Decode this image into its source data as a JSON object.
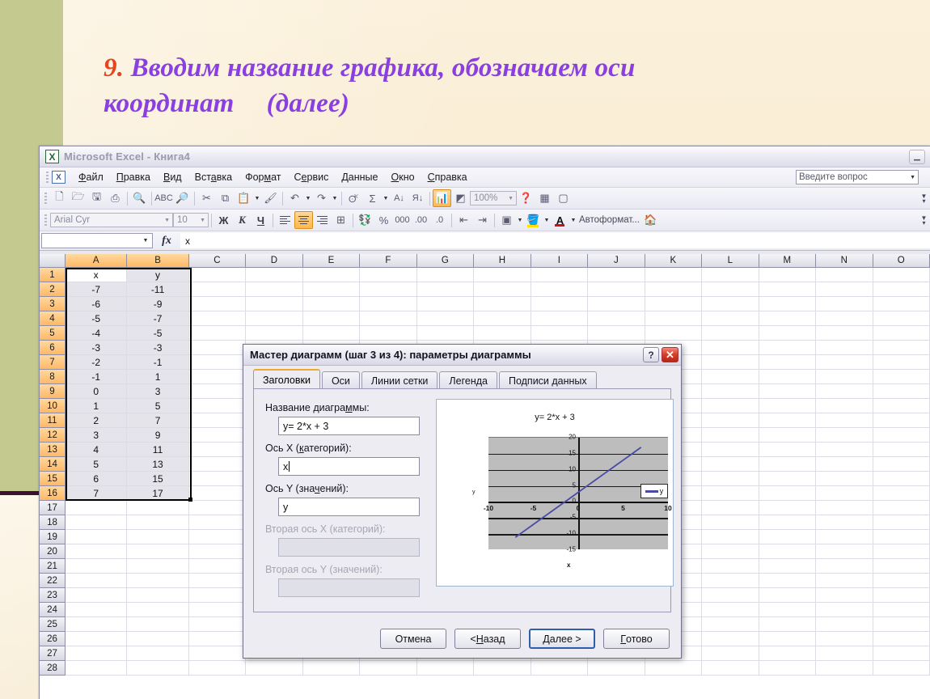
{
  "slide": {
    "number": "9.",
    "title_line1": "Вводим название графика, обозначаем оси",
    "title_line2": "координат",
    "title_line2b": "(далее)",
    "accent_color": "#8a3fe0",
    "number_color": "#e8441c",
    "band_color": "#c3c98f",
    "rule_color": "#3b1033"
  },
  "excel": {
    "title": "Microsoft Excel - Книга4",
    "logo": "excel-logo-icon",
    "window_buttons": [
      "minimize-button"
    ],
    "menu": [
      "Файл",
      "Правка",
      "Вид",
      "Вставка",
      "Формат",
      "Сервис",
      "Данные",
      "Окно",
      "Справка"
    ],
    "ask_box": {
      "placeholder": "Введите вопрос"
    },
    "standard_toolbar": [
      {
        "name": "new-icon",
        "glyph": "▯"
      },
      {
        "name": "open-icon",
        "glyph": "▤"
      },
      {
        "name": "save-icon",
        "glyph": "▣"
      },
      {
        "name": "print-icon",
        "glyph": "⎙"
      },
      {
        "name": "print-preview-icon",
        "glyph": "▦"
      },
      {
        "name": "spellcheck-icon",
        "glyph": "✓"
      },
      {
        "name": "research-icon",
        "glyph": "▥"
      },
      {
        "name": "cut-icon",
        "glyph": "✂"
      },
      {
        "name": "copy-icon",
        "glyph": "▭"
      },
      {
        "name": "paste-icon",
        "glyph": "▨"
      },
      {
        "name": "format-painter-icon",
        "glyph": "✐"
      },
      {
        "name": "undo-icon",
        "glyph": "↰"
      },
      {
        "name": "redo-icon",
        "glyph": "↱"
      },
      {
        "name": "hyperlink-icon",
        "glyph": "◕"
      },
      {
        "name": "autosum-icon",
        "glyph": "Σ"
      },
      {
        "name": "sort-asc-icon",
        "glyph": "A↓"
      },
      {
        "name": "sort-desc-icon",
        "glyph": "Я↓"
      },
      {
        "name": "chart-wizard-icon",
        "glyph": "▮▯▮"
      },
      {
        "name": "drawing-icon",
        "glyph": "◩"
      },
      {
        "name": "help-icon",
        "glyph": "?"
      },
      {
        "name": "window-icon",
        "glyph": "▧"
      },
      {
        "name": "new-window-icon",
        "glyph": "▢"
      }
    ],
    "zoom": "100%",
    "formatting_toolbar": {
      "font": "Arial Cyr",
      "size": "10",
      "bold": "Ж",
      "italic": "К",
      "underline": "Ч",
      "percent": "%",
      "thousands": "000",
      "autoformat": "Автоформат...",
      "icons": [
        "align-left-icon",
        "align-center-icon",
        "align-right-icon",
        "merge-cells-icon",
        "currency-icon",
        "increase-decimal-icon",
        "decrease-decimal-icon",
        "decrease-indent-icon",
        "increase-indent-icon",
        "borders-icon",
        "fill-color-icon",
        "font-color-icon",
        "autoformat-icon"
      ]
    },
    "formula_bar": {
      "name_box": "",
      "formula": "x"
    },
    "columns": [
      "A",
      "B",
      "C",
      "D",
      "E",
      "F",
      "G",
      "H",
      "I",
      "J",
      "K",
      "L",
      "M",
      "N",
      "O"
    ],
    "selected_columns": [
      "A",
      "B"
    ],
    "rows": [
      "1",
      "2",
      "3",
      "4",
      "5",
      "6",
      "7",
      "8",
      "9",
      "10",
      "11",
      "12",
      "13",
      "14",
      "15",
      "16",
      "17",
      "18",
      "19",
      "20",
      "21",
      "22",
      "23",
      "24",
      "25",
      "26",
      "27",
      "28"
    ],
    "selected_rows": [
      "1",
      "2",
      "3",
      "4",
      "5",
      "6",
      "7",
      "8",
      "9",
      "10",
      "11",
      "12",
      "13",
      "14",
      "15",
      "16"
    ],
    "sheet_data": [
      [
        "x",
        "y"
      ],
      [
        "-7",
        "-11"
      ],
      [
        "-6",
        "-9"
      ],
      [
        "-5",
        "-7"
      ],
      [
        "-4",
        "-5"
      ],
      [
        "-3",
        "-3"
      ],
      [
        "-2",
        "-1"
      ],
      [
        "-1",
        "1"
      ],
      [
        "0",
        "3"
      ],
      [
        "1",
        "5"
      ],
      [
        "2",
        "7"
      ],
      [
        "3",
        "9"
      ],
      [
        "4",
        "11"
      ],
      [
        "5",
        "13"
      ],
      [
        "6",
        "15"
      ],
      [
        "7",
        "17"
      ]
    ],
    "active_cell": "A1"
  },
  "dialog": {
    "title": "Мастер диаграмм (шаг 3 из 4): параметры диаграммы",
    "help_button": "?",
    "close_button": "✕",
    "tabs": [
      {
        "label": "Заголовки",
        "active": true
      },
      {
        "label": "Оси",
        "active": false
      },
      {
        "label": "Линии сетки",
        "active": false
      },
      {
        "label": "Легенда",
        "active": false
      },
      {
        "label": "Подписи данных",
        "active": false
      }
    ],
    "fields": [
      {
        "label": "Название диаграммы:",
        "value": "y= 2*x + 3",
        "disabled": false,
        "focused": false
      },
      {
        "label": "Ось X (категорий):",
        "value": "x",
        "disabled": false,
        "focused": true
      },
      {
        "label": "Ось Y (значений):",
        "value": "y",
        "disabled": false,
        "focused": false
      },
      {
        "label": "Вторая ось X (категорий):",
        "value": "",
        "disabled": true,
        "focused": false
      },
      {
        "label": "Вторая ось Y (значений):",
        "value": "",
        "disabled": true,
        "focused": false
      }
    ],
    "buttons": [
      {
        "label": "Отмена",
        "default": false
      },
      {
        "label": "< Назад",
        "default": false
      },
      {
        "label": "Далее >",
        "default": true
      },
      {
        "label": "Готово",
        "default": false
      }
    ]
  },
  "chart_data": {
    "type": "line",
    "title": "y= 2*x + 3",
    "xlabel": "x",
    "ylabel": "y",
    "x": [
      -7,
      -6,
      -5,
      -4,
      -3,
      -2,
      -1,
      0,
      1,
      2,
      3,
      4,
      5,
      6,
      7
    ],
    "series": [
      {
        "name": "y",
        "values": [
          -11,
          -9,
          -7,
          -5,
          -3,
          -1,
          1,
          3,
          5,
          7,
          9,
          11,
          13,
          15,
          17
        ],
        "color": "#4a4aa8"
      }
    ],
    "xlim": [
      -10,
      10
    ],
    "ylim": [
      -15,
      20
    ],
    "xticks": [
      "-10",
      "-5",
      "0",
      "5",
      "10"
    ],
    "yticks": [
      "20",
      "15",
      "10",
      "5",
      "0",
      "-5",
      "-10",
      "-15"
    ],
    "grid": true,
    "legend": [
      "y"
    ],
    "legend_position": "right",
    "plot_bg": "#bdbdbd"
  }
}
